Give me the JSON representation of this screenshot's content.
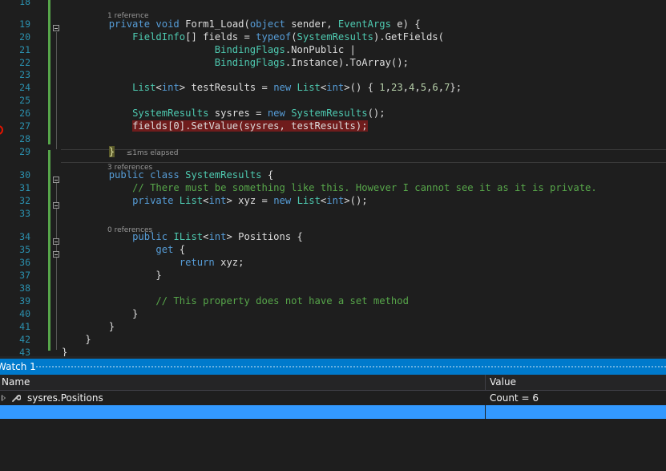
{
  "editor": {
    "lines": [
      {
        "n": "18",
        "code": []
      },
      {
        "n": "19",
        "lens": "1 reference",
        "code": [
          {
            "t": "        "
          },
          {
            "t": "private",
            "c": "kw"
          },
          {
            "t": " "
          },
          {
            "t": "void",
            "c": "kw"
          },
          {
            "t": " Form1_Load("
          },
          {
            "t": "object",
            "c": "kw"
          },
          {
            "t": " sender, "
          },
          {
            "t": "EventArgs",
            "c": "ty"
          },
          {
            "t": " e) {"
          }
        ]
      },
      {
        "n": "20",
        "code": [
          {
            "t": "            "
          },
          {
            "t": "FieldInfo",
            "c": "ty"
          },
          {
            "t": "[] fields = "
          },
          {
            "t": "typeof",
            "c": "kw"
          },
          {
            "t": "("
          },
          {
            "t": "SystemResults",
            "c": "ty"
          },
          {
            "t": ").GetFields("
          }
        ]
      },
      {
        "n": "21",
        "code": [
          {
            "t": "                          "
          },
          {
            "t": "BindingFlags",
            "c": "ty"
          },
          {
            "t": ".NonPublic |"
          }
        ]
      },
      {
        "n": "22",
        "code": [
          {
            "t": "                          "
          },
          {
            "t": "BindingFlags",
            "c": "ty"
          },
          {
            "t": ".Instance).ToArray();"
          }
        ]
      },
      {
        "n": "23",
        "code": []
      },
      {
        "n": "24",
        "code": [
          {
            "t": "            "
          },
          {
            "t": "List",
            "c": "ty"
          },
          {
            "t": "<"
          },
          {
            "t": "int",
            "c": "kw"
          },
          {
            "t": "> testResults = "
          },
          {
            "t": "new",
            "c": "kw"
          },
          {
            "t": " "
          },
          {
            "t": "List",
            "c": "ty"
          },
          {
            "t": "<"
          },
          {
            "t": "int",
            "c": "kw"
          },
          {
            "t": ">() { "
          },
          {
            "t": "1",
            "c": "nm"
          },
          {
            "t": ","
          },
          {
            "t": "23",
            "c": "nm"
          },
          {
            "t": ","
          },
          {
            "t": "4",
            "c": "nm"
          },
          {
            "t": ","
          },
          {
            "t": "5",
            "c": "nm"
          },
          {
            "t": ","
          },
          {
            "t": "6",
            "c": "nm"
          },
          {
            "t": ","
          },
          {
            "t": "7",
            "c": "nm"
          },
          {
            "t": "};"
          }
        ]
      },
      {
        "n": "25",
        "code": []
      },
      {
        "n": "26",
        "code": [
          {
            "t": "            "
          },
          {
            "t": "SystemResults",
            "c": "ty"
          },
          {
            "t": " sysres = "
          },
          {
            "t": "new",
            "c": "kw"
          },
          {
            "t": " "
          },
          {
            "t": "SystemResults",
            "c": "ty"
          },
          {
            "t": "();"
          }
        ]
      },
      {
        "n": "27",
        "bp": true,
        "code": [
          {
            "t": "            "
          },
          {
            "t": "fields[0].SetValue(sysres, testResults);",
            "c": "bp-hl"
          }
        ]
      },
      {
        "n": "28",
        "code": []
      },
      {
        "n": "29",
        "current": true,
        "code": [
          {
            "t": "        "
          },
          {
            "t": "}",
            "c": "brace-hl"
          },
          {
            "t": "  "
          },
          {
            "t": "≤1ms elapsed",
            "c": "elapsed"
          }
        ]
      },
      {
        "n": "30",
        "lens": "3 references",
        "code": [
          {
            "t": "        "
          },
          {
            "t": "public",
            "c": "kw"
          },
          {
            "t": " "
          },
          {
            "t": "class",
            "c": "kw"
          },
          {
            "t": " "
          },
          {
            "t": "SystemResults",
            "c": "ty"
          },
          {
            "t": " {"
          }
        ]
      },
      {
        "n": "31",
        "code": [
          {
            "t": "            "
          },
          {
            "t": "// There must be something like this. However I cannot see it as it is private.",
            "c": "cm"
          }
        ]
      },
      {
        "n": "32",
        "code": [
          {
            "t": "            "
          },
          {
            "t": "private",
            "c": "kw"
          },
          {
            "t": " "
          },
          {
            "t": "List",
            "c": "ty"
          },
          {
            "t": "<"
          },
          {
            "t": "int",
            "c": "kw"
          },
          {
            "t": "> xyz = "
          },
          {
            "t": "new",
            "c": "kw"
          },
          {
            "t": " "
          },
          {
            "t": "List",
            "c": "ty"
          },
          {
            "t": "<"
          },
          {
            "t": "int",
            "c": "kw"
          },
          {
            "t": ">();"
          }
        ]
      },
      {
        "n": "33",
        "code": []
      },
      {
        "n": "34",
        "lens": "0 references",
        "code": [
          {
            "t": "            "
          },
          {
            "t": "public",
            "c": "kw"
          },
          {
            "t": " "
          },
          {
            "t": "IList",
            "c": "ty"
          },
          {
            "t": "<"
          },
          {
            "t": "int",
            "c": "kw"
          },
          {
            "t": "> Positions {"
          }
        ]
      },
      {
        "n": "35",
        "code": [
          {
            "t": "                "
          },
          {
            "t": "get",
            "c": "kw"
          },
          {
            "t": " {"
          }
        ]
      },
      {
        "n": "36",
        "code": [
          {
            "t": "                    "
          },
          {
            "t": "return",
            "c": "kw"
          },
          {
            "t": " xyz;"
          }
        ]
      },
      {
        "n": "37",
        "code": [
          {
            "t": "                }"
          }
        ]
      },
      {
        "n": "38",
        "code": []
      },
      {
        "n": "39",
        "code": [
          {
            "t": "                "
          },
          {
            "t": "// This property does not have a set method",
            "c": "cm"
          }
        ]
      },
      {
        "n": "40",
        "code": [
          {
            "t": "            }"
          }
        ]
      },
      {
        "n": "41",
        "code": [
          {
            "t": "        }"
          }
        ]
      },
      {
        "n": "42",
        "code": [
          {
            "t": "    }"
          }
        ]
      },
      {
        "n": "43",
        "code": [
          {
            "t": "}"
          }
        ]
      }
    ]
  },
  "watch": {
    "title": "Watch 1",
    "columns": {
      "name": "Name",
      "value": "Value"
    },
    "rows": [
      {
        "name": "sysres.Positions",
        "value": "Count = 6"
      }
    ]
  },
  "colors": {
    "keyword": "#569cd6",
    "type": "#4ec9b0",
    "comment": "#57a64a",
    "line_number": "#2b91af",
    "breakpoint_line": "#6f1c1c",
    "selection": "#3399ff",
    "tool_window_title": "#007acc"
  }
}
